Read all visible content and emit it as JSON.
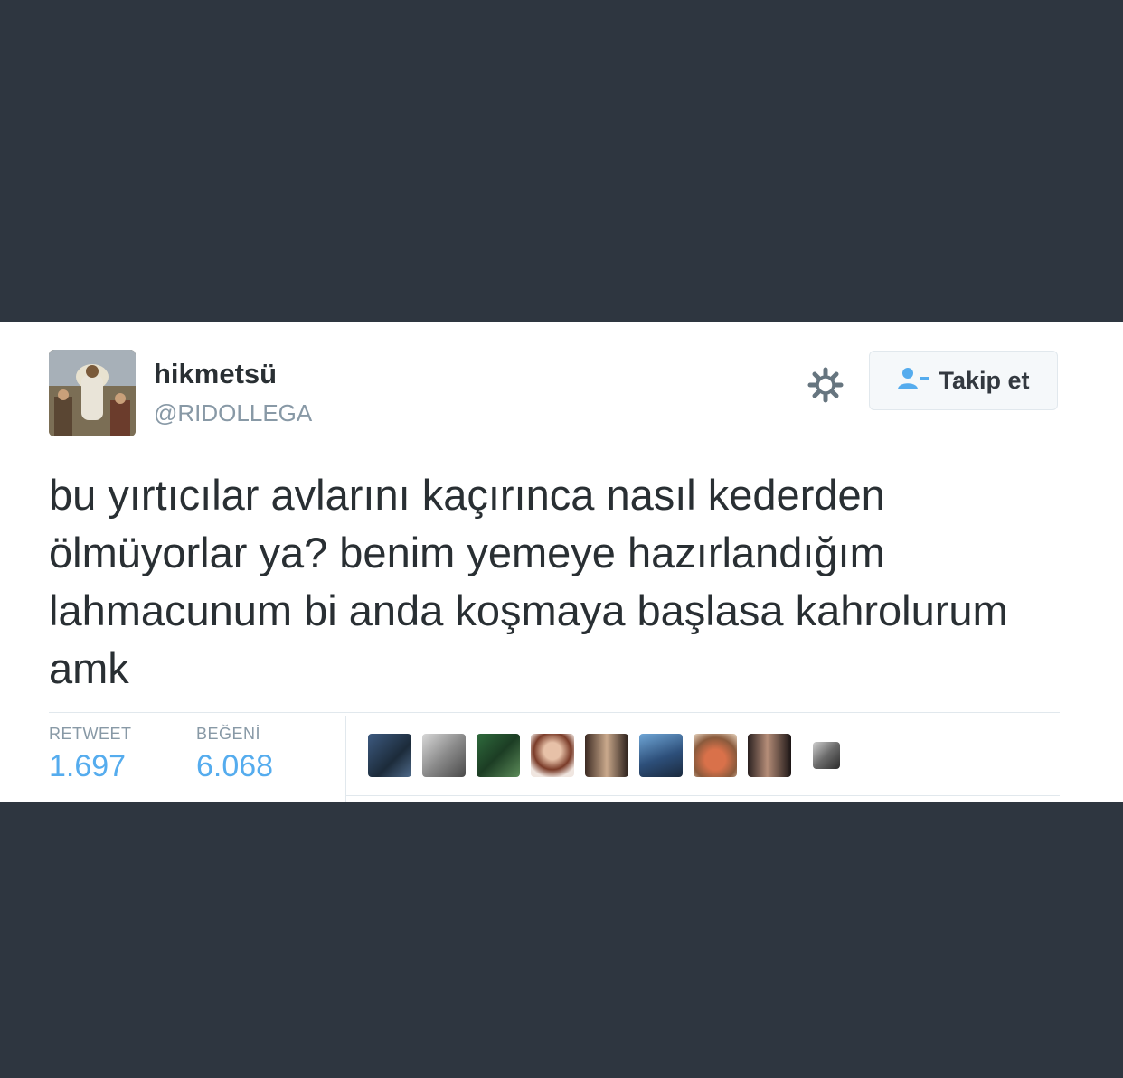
{
  "user": {
    "display_name": "hikmetsü",
    "handle": "@RIDOLLEGA"
  },
  "follow_button": {
    "label": "Takip et",
    "icon": "add-user-icon"
  },
  "settings": {
    "icon": "gear-icon"
  },
  "tweet": {
    "text": "bu yırtıcılar avlarını kaçırınca nasıl kederden ölmüyorlar ya? benim yemeye hazırlandığım lahmacunum bi anda koşmaya başlasa kahrolurum amk"
  },
  "stats": {
    "retweet_label": "RETWEET",
    "retweet_count": "1.697",
    "like_label": "BEĞENİ",
    "like_count": "6.068"
  },
  "likers_count_shown": 9,
  "colors": {
    "background": "#2e3640",
    "card": "#ffffff",
    "text": "#292f33",
    "muted": "#8899a6",
    "accent": "#55acee"
  }
}
